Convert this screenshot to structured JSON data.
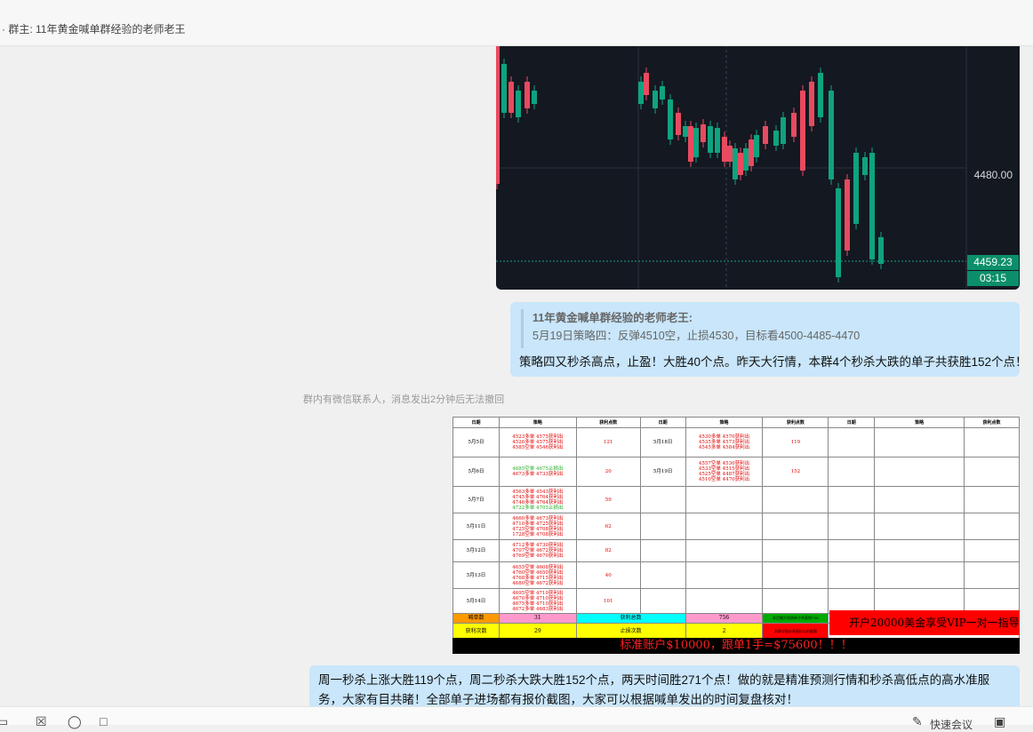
{
  "header": {
    "title": "· 群主: 11年黄金喊单群经验的老师老王"
  },
  "chart": {
    "price_mid": "4480.00",
    "last_price": "4459.23",
    "countdown": "03:15",
    "up_color": "#e84a5f",
    "down_color": "#0fa37f"
  },
  "message1": {
    "quote_author": "11年黄金喊单群经验的老师老王:",
    "quote_text": "5月19日策略四：反弹4510空，止损4530，目标看4500-4485-4470",
    "text": "策略四又秒杀高点，止盈！大胜40个点。昨天大行情，本群4个秒杀大跌的单子共获胜152个点！"
  },
  "notice": "群内有微信联系人，消息发出2分钟后无法撤回",
  "table_image": {
    "headers": [
      "日期",
      "策略",
      "获利点数",
      "日期",
      "策略",
      "获利点数",
      "日期",
      "策略",
      "获利点数"
    ],
    "rows": [
      {
        "date": "5月5日",
        "strategy": [
          "4523多单 4575获利出",
          "4526多单 4575获利出",
          "4585空单 4546获利出"
        ],
        "points": "121",
        "date2": "5月18日",
        "strategy2": [
          "4530多单 4570获利出",
          "4535多单 4573获利出",
          "4545多单 4584获利出"
        ],
        "points2": "119"
      },
      {
        "date": "5月6日",
        "strategy": [
          "4685空单 4675止损出",
          "4673多单 4733获利出"
        ],
        "points": "20",
        "date2": "5月19日",
        "strategy2": [
          "4557空单 4530获利出",
          "4533空单 4515获利出",
          "4525空单 4487获利出",
          "4510空单 4470获利出"
        ],
        "points2": "152"
      },
      {
        "date": "5月7日",
        "strategy": [
          "4563多单 4543获利出",
          "4745多单 4764获利出",
          "4746多单 4764获利出",
          "4722多单 4705止损出"
        ],
        "points": "59"
      },
      {
        "date": "5月11日",
        "strategy": [
          "4660多单 4673获利出",
          "4710多单 4725获利出",
          "4725空单 4708获利出",
          "1728空单 4708获利出"
        ],
        "points": "62"
      },
      {
        "date": "5月12日",
        "strategy": [
          "4712多单 4730获利出",
          "4707空单 4672获利出",
          "4769空单 4670获利出"
        ],
        "points": "82"
      },
      {
        "date": "5月13日",
        "strategy": [
          "4655空单 4608获利出",
          "4760空单 4650获利出",
          "4768多单 4715获利出",
          "4680空单 4672获利出"
        ],
        "points": "40"
      },
      {
        "date": "5月14日",
        "strategy": [
          "4695空单 4710获利出",
          "4670多单 4710获利出",
          "4675多单 4710获利出",
          "4672多单 4683获利出"
        ],
        "points": "101"
      }
    ],
    "summary": {
      "calls_label": "喊单数",
      "calls": "31",
      "total_label": "获利总数",
      "total": "756",
      "wins_label": "获利次数",
      "wins": "29",
      "stops_label": "止损次数",
      "stops": "2",
      "small_green": "本月喊大利润单子共获利756",
      "small_red": "本群详细分享报价以附截图"
    },
    "promo": "开户20000美金享受VIP一对一指导",
    "bottom": "标准账户$10000，跟单1手=$75600！！！"
  },
  "message2": {
    "text": "周一秒杀上涨大胜119个点，周二秒杀大跌大胜152个点，两天时间胜271个点！做的就是精准预测行情和秒杀高低点的高水准服务，大家有目共睹！全部单子进场都有报价截图，大家可以根据喊单发出的时间复盘核对！"
  },
  "input": {
    "quick_reply": "快速会议"
  }
}
